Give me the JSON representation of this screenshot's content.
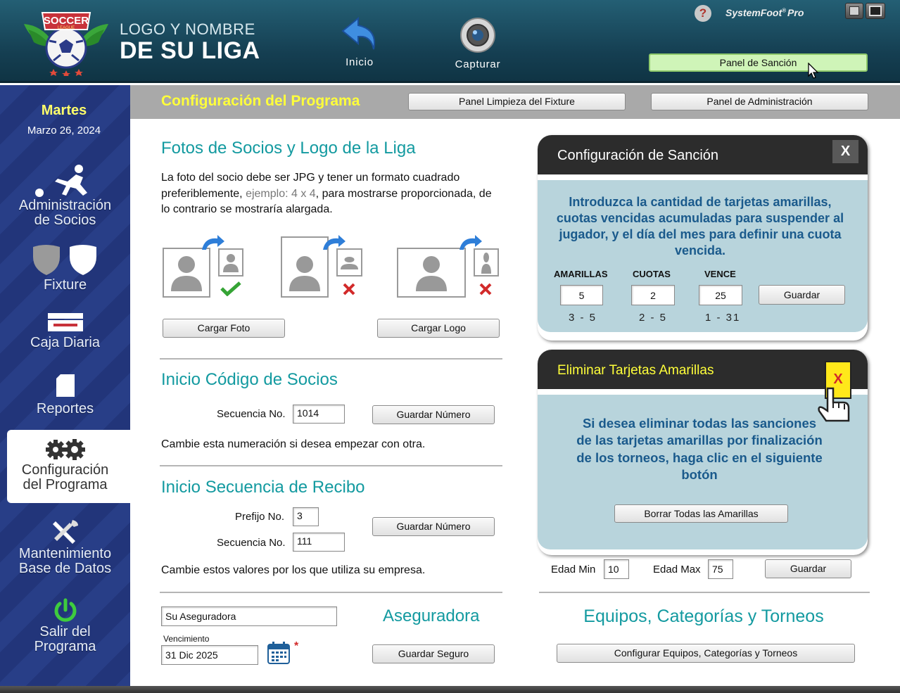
{
  "header": {
    "league_line1": "LOGO Y NOMBRE",
    "league_line2": "DE SU LIGA",
    "logo_text": "SOCCER",
    "logo_subtext": "LEAGUE",
    "nav_home_label": "Inicio",
    "nav_capture_label": "Capturar",
    "help_glyph": "?",
    "brand": "SystemFoot",
    "brand_sup": "®",
    "brand_suffix": "Pro",
    "sancion_button": "Panel de Sanción"
  },
  "sidebar": {
    "day": "Martes",
    "date": "Marzo 26, 2024",
    "items": [
      {
        "label_line1": "Administración",
        "label_line2": "de Socios",
        "icon": "player-kick-icon"
      },
      {
        "label_line1": "Fixture",
        "label_line2": "",
        "icon": "shields-icon"
      },
      {
        "label_line1": "Caja Diaria",
        "label_line2": "",
        "icon": "cash-box-icon"
      },
      {
        "label_line1": "Reportes",
        "label_line2": "",
        "icon": "report-icon"
      },
      {
        "label_line1": "Configuración",
        "label_line2": "del Programa",
        "icon": "gears-icon"
      },
      {
        "label_line1": "Mantenimiento",
        "label_line2": "Base de Datos",
        "icon": "tools-icon"
      },
      {
        "label_line1": "Salir del",
        "label_line2": "Programa",
        "icon": "power-icon"
      }
    ]
  },
  "topbar": {
    "title": "Configuración del Programa",
    "fixture_clean_button": "Panel Limpieza del Fixture",
    "admin_button": "Panel de Administración"
  },
  "photos": {
    "title": "Fotos de Socios y Logo de la Liga",
    "desc_part1": "La foto del socio debe ser JPG y tener un formato cuadrado preferiblemente, ",
    "desc_example": "ejemplo: 4 x 4",
    "desc_part2": ", para mostrarse proporcionada, de lo contrario se mostraría alargada.",
    "load_photo_button": "Cargar Foto",
    "load_logo_button": "Cargar Logo"
  },
  "member_code": {
    "title": "Inicio Código de Socios",
    "seq_label": "Secuencia No.",
    "seq_value": "1014",
    "save_button": "Guardar Número",
    "note": "Cambie esta numeración si desea empezar con otra."
  },
  "receipt": {
    "title": "Inicio Secuencia de Recibo",
    "prefix_label": "Prefijo No.",
    "prefix_value": "3",
    "seq_label": "Secuencia No.",
    "seq_value": "111",
    "save_button": "Guardar Número",
    "note": "Cambie estos valores por los que utiliza su empresa."
  },
  "insurance": {
    "name_value": "Su Aseguradora",
    "title": "Aseguradora",
    "expiry_label": "Vencimiento",
    "expiry_value": "31 Dic 2025",
    "required_mark": "*",
    "save_button": "Guardar Seguro"
  },
  "sanction_panel": {
    "title": "Configuración de Sanción",
    "close": "X",
    "message": "Introduzca la cantidad de tarjetas amarillas, cuotas vencidas acumuladas para suspender al jugador, y el día del mes para definir una cuota vencida.",
    "yellow_label": "AMARILLAS",
    "yellow_value": "5",
    "yellow_range": "3 - 5",
    "fees_label": "CUOTAS",
    "fees_value": "2",
    "fees_range": "2 - 5",
    "due_label": "VENCE",
    "due_value": "25",
    "due_range": "1 - 31",
    "save_button": "Guardar"
  },
  "yellow_panel": {
    "title": "Eliminar Tarjetas Amarillas",
    "card_mark": "X",
    "message": "Si desea eliminar todas las sanciones de las tarjetas amarillas por finalización de los torneos, haga clic en el siguiente botón",
    "delete_button": "Borrar Todas las Amarillas"
  },
  "age": {
    "min_label": "Edad Min",
    "min_value": "10",
    "max_label": "Edad Max",
    "max_value": "75",
    "save_button": "Guardar"
  },
  "teams": {
    "title": "Equipos, Categorías y Torneos",
    "config_button": "Configurar Equipos, Categorías y Torneos"
  },
  "colors": {
    "header_bg": "#1a4a5e",
    "sidebar_bg": "#283e87",
    "accent_teal": "#139aa0",
    "title_yellow": "#ffff3a",
    "panel_body": "#b8d4dc",
    "message_blue": "#1a5a8c",
    "sancion_green": "#cff4b8"
  }
}
